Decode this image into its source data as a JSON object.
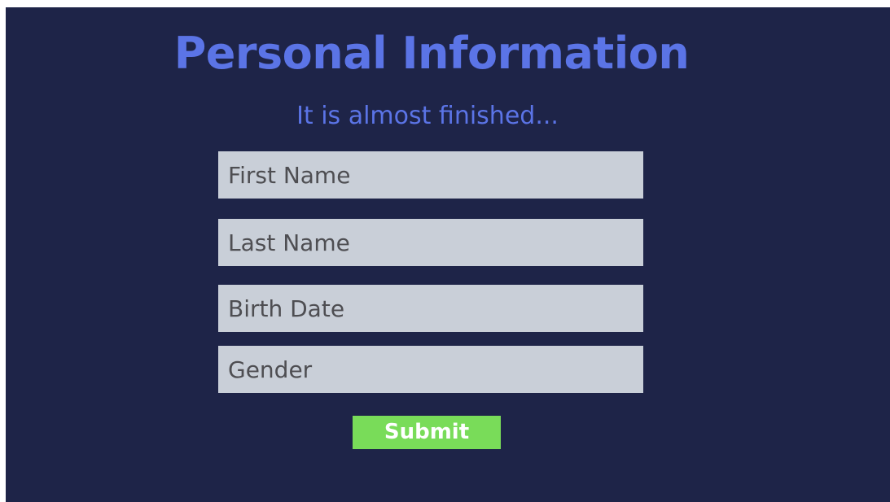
{
  "page": {
    "title": "Personal Information",
    "subtitle": "It is almost finished..."
  },
  "form": {
    "fields": [
      {
        "placeholder": "First Name",
        "value": ""
      },
      {
        "placeholder": "Last Name",
        "value": ""
      },
      {
        "placeholder": "Birth Date",
        "value": ""
      },
      {
        "placeholder": "Gender",
        "value": ""
      }
    ],
    "submit_label": "Submit"
  },
  "colors": {
    "background": "#1e2448",
    "accent": "#5b74e6",
    "field_background": "#c9cfd8",
    "field_text": "#4e4e52",
    "submit_background": "#79dc59",
    "submit_text": "#ffffff"
  }
}
